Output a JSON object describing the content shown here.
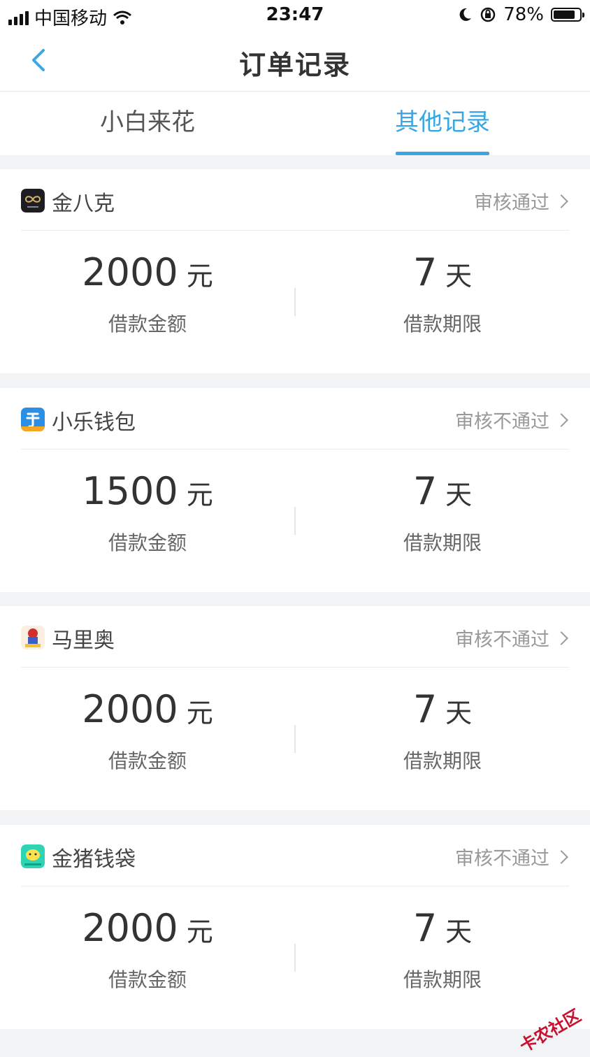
{
  "statusbar": {
    "carrier": "中国移动",
    "time": "23:47",
    "battery": "78%"
  },
  "navbar": {
    "title": "订单记录"
  },
  "tabs": [
    {
      "label": "小白来花",
      "active": false
    },
    {
      "label": "其他记录",
      "active": true
    }
  ],
  "orders": [
    {
      "app": "金八克",
      "icon": "jinbake-app-icon",
      "status": "审核通过",
      "amount": "2000",
      "amount_unit": "元",
      "amount_label": "借款金额",
      "term": "7",
      "term_unit": "天",
      "term_label": "借款期限"
    },
    {
      "app": "小乐钱包",
      "icon": "xiaole-app-icon",
      "status": "审核不通过",
      "amount": "1500",
      "amount_unit": "元",
      "amount_label": "借款金额",
      "term": "7",
      "term_unit": "天",
      "term_label": "借款期限"
    },
    {
      "app": "马里奥",
      "icon": "mario-app-icon",
      "status": "审核不通过",
      "amount": "2000",
      "amount_unit": "元",
      "amount_label": "借款金额",
      "term": "7",
      "term_unit": "天",
      "term_label": "借款期限"
    },
    {
      "app": "金猪钱袋",
      "icon": "jinzhu-app-icon",
      "status": "审核不通过",
      "amount": "2000",
      "amount_unit": "元",
      "amount_label": "借款金额",
      "term": "7",
      "term_unit": "天",
      "term_label": "借款期限"
    }
  ],
  "watermark": "卡农社区",
  "colors": {
    "accent": "#3aa7e4"
  }
}
